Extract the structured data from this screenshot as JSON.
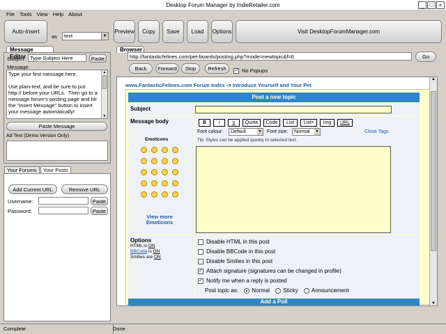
{
  "window": {
    "title": "Desktop Forum Manager by IndieRetailer.com"
  },
  "menu": [
    "File",
    "Tools",
    "View",
    "Help",
    "About"
  ],
  "toolbar": {
    "auto_insert": "Auto-Insert",
    "as_label": "as",
    "as_select": "text",
    "preview": "Preview",
    "copy": "Copy",
    "save": "Save",
    "load": "Load",
    "options": "Options",
    "visit": "Visit DesktopForumManager.com"
  },
  "editor": {
    "header": "Message Editor",
    "subject_label": "Subject",
    "subject_value": "Type Subject Here",
    "paste": "Paste",
    "message_label": "Message:",
    "message_text": "Type your first message here.\n\nUse plain-text, and be sure to put http:// before your URLs.  Then go to a message forum's posting page and hit the \"Insert Message\" button to insert your message automatically!",
    "paste_message": "Paste Message",
    "ad_text": "Ad Text (Demo Version Only)"
  },
  "forums": {
    "tab_forums": "Your Forums",
    "tab_posts": "Your Posts",
    "add_url": "Add Current URL",
    "remove_url": "Remove URL",
    "username_label": "Username:",
    "password_label": "Password:",
    "paste": "Paste"
  },
  "browser": {
    "header": "Browser",
    "url": "http://fantasticfelines.com/pet-boards/posting.php?mode=newtopic&f=6",
    "go": "Go",
    "back": "Back",
    "forward": "Forward",
    "stop": "Stop",
    "refresh": "Refresh",
    "no_popups": "No Popups"
  },
  "page": {
    "breadcrumb_site": "www.FantasticFelines.com Forum Index",
    "breadcrumb_sep": "->",
    "breadcrumb_topic": "Introduce Yourself and Your Pet",
    "post_title": "Post a new topic",
    "subject_label": "Subject",
    "body_label": "Message body",
    "emoticons_label": "Emoticons",
    "view_more": "View more Emoticons",
    "format_buttons": [
      "B",
      "i",
      "u",
      "Quote",
      "Code",
      "List",
      "List=",
      "Img",
      "URL"
    ],
    "font_colour_label": "Font colour:",
    "font_colour_value": "Default",
    "font_size_label": "Font size:",
    "font_size_value": "Normal",
    "close_tags": "Close Tags",
    "tip": "Tip: Styles can be applied quickly to selected text.",
    "options_label": "Options",
    "html_label": "HTML is",
    "html_state": "ON",
    "bbcode_label": "BBCode",
    "bbcode_is": "is",
    "bbcode_state": "ON",
    "smilies_label": "Smilies are",
    "smilies_state": "ON",
    "checkboxes": [
      {
        "label": "Disable HTML in this post",
        "checked": false
      },
      {
        "label": "Disable BBCode in this post",
        "checked": false
      },
      {
        "label": "Disable Smilies in this post",
        "checked": false
      },
      {
        "label": "Attach signature (signatures can be changed in profile)",
        "checked": true
      },
      {
        "label": "Notify me when a reply is posted",
        "checked": true
      }
    ],
    "post_topic_as": "Post topic as:",
    "radio_normal": "Normal",
    "radio_sticky": "Sticky",
    "radio_announcement": "Announcement",
    "add_poll": "Add a Poll"
  },
  "status": {
    "left": "Complete",
    "right": "Done"
  },
  "colors": {
    "accent_bar": "#2e86c8",
    "link": "#1a5a9a",
    "yellow": "#ffffcc"
  }
}
